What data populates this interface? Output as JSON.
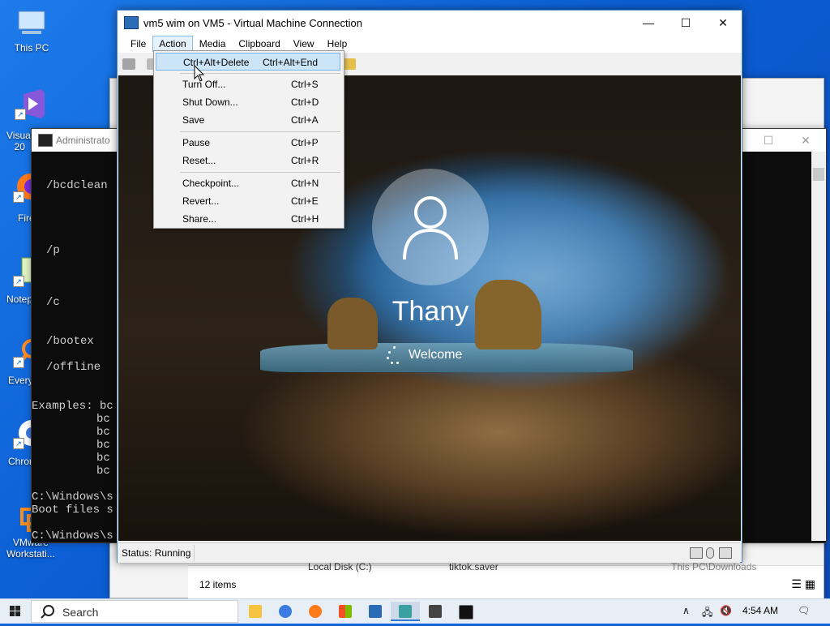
{
  "desktop": {
    "icons": [
      {
        "label": "This PC"
      },
      {
        "label": "Visual\n20"
      },
      {
        "label": "Fire"
      },
      {
        "label": "Notep"
      },
      {
        "label": "Every"
      },
      {
        "label": "Chron"
      },
      {
        "label": "VMware\nWorkstati..."
      }
    ]
  },
  "cmd_window": {
    "title": "Administrato",
    "lines": [
      "/bcdclean",
      "/p",
      "/c",
      "/bootex",
      "/offline",
      "Examples: bc",
      "bc",
      "bc",
      "bc",
      "bc",
      "bc",
      "C:\\Windows\\s",
      "Boot files s",
      "C:\\Windows\\s"
    ]
  },
  "explorer_window": {
    "items_count": "12 items",
    "partial_labels": [
      "Local Disk (C:)",
      "tiktok.saver",
      "This PC\\Downloads"
    ]
  },
  "vm_window": {
    "title": "vm5 wim on VM5 - Virtual Machine Connection",
    "menu": [
      "File",
      "Action",
      "Media",
      "Clipboard",
      "View",
      "Help"
    ],
    "active_menu": "Action",
    "status": "Status: Running"
  },
  "guest_screen": {
    "username": "Thany",
    "message": "Welcome"
  },
  "action_menu": {
    "items": [
      {
        "label": "Ctrl+Alt+Delete",
        "shortcut": "Ctrl+Alt+End",
        "highlighted": true
      },
      {
        "label": "Turn Off...",
        "shortcut": "Ctrl+S"
      },
      {
        "label": "Shut Down...",
        "shortcut": "Ctrl+D"
      },
      {
        "label": "Save",
        "shortcut": "Ctrl+A"
      },
      {
        "label": "Pause",
        "shortcut": "Ctrl+P"
      },
      {
        "label": "Reset...",
        "shortcut": "Ctrl+R"
      },
      {
        "label": "Checkpoint...",
        "shortcut": "Ctrl+N"
      },
      {
        "label": "Revert...",
        "shortcut": "Ctrl+E"
      },
      {
        "label": "Share...",
        "shortcut": "Ctrl+H"
      }
    ]
  },
  "taskbar": {
    "search_placeholder": "Search",
    "time": "4:54 AM",
    "apps": [
      "file-explorer",
      "chrome",
      "firefox",
      "microsoft-store",
      "hyper-v-manager",
      "vm-connection",
      "app-7",
      "cmd"
    ]
  },
  "colors": {
    "desktop": "#0b5ed4",
    "menu_highlight": "#cce4f7",
    "window_border": "#4b87c9"
  }
}
